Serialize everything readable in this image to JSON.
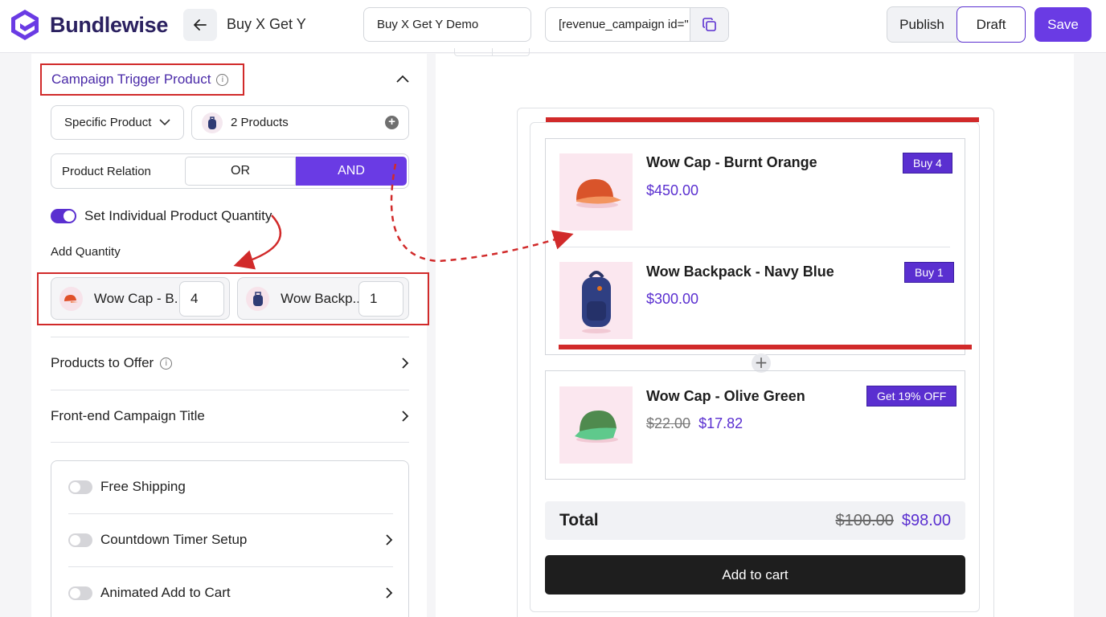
{
  "header": {
    "brand": "Bundlewise",
    "campaign_name": "Buy X Get Y",
    "title_value": "Buy X Get Y Demo",
    "shortcode_value": "[revenue_campaign id=\"",
    "publish_label": "Publish",
    "draft_label": "Draft",
    "save_label": "Save"
  },
  "trigger": {
    "title": "Campaign Trigger Product",
    "info_glyph": "i",
    "select_value": "Specific Product",
    "products_value": "2 Products",
    "relation_label": "Product Relation",
    "relation_or": "OR",
    "relation_and": "AND",
    "relation_selected": "AND",
    "individual_qty_label": "Set Individual Product Quantity",
    "individual_qty_enabled": true,
    "add_qty_label": "Add Quantity",
    "qty_items": [
      {
        "name": "Wow Cap - B...",
        "qty": "4"
      },
      {
        "name": "Wow Backp...",
        "qty": "1"
      }
    ]
  },
  "sections": {
    "products_to_offer": "Products to Offer",
    "frontend_title": "Front-end Campaign Title"
  },
  "options": [
    {
      "label": "Free Shipping",
      "enabled": false,
      "has_chevron": false
    },
    {
      "label": "Countdown Timer Setup",
      "enabled": false,
      "has_chevron": true
    },
    {
      "label": "Animated Add to Cart",
      "enabled": false,
      "has_chevron": true
    }
  ],
  "preview": {
    "buy_items": [
      {
        "name": "Wow Cap - Burnt Orange",
        "price": "$450.00",
        "badge": "Buy 4"
      },
      {
        "name": "Wow Backpack - Navy Blue",
        "price": "$300.00",
        "badge": "Buy 1"
      }
    ],
    "plus_glyph": "+",
    "get_item": {
      "name": "Wow Cap - Olive Green",
      "old_price": "$22.00",
      "price": "$17.82",
      "badge": "Get 19% OFF"
    },
    "total_label": "Total",
    "total_old": "$100.00",
    "total_new": "$98.00",
    "cart_label": "Add to cart"
  },
  "colors": {
    "accent": "#6a3be4",
    "brand_dark": "#2b2160",
    "annotation_red": "#d12a2a",
    "thumb_bg": "#fbe7ef"
  },
  "icons": {
    "logo": "bundlewise-logo-icon",
    "back": "arrow-left-icon",
    "copy": "copy-icon",
    "collapse": "chevron-up-icon",
    "dropdown": "chevron-down-icon",
    "add": "plus-circle-icon",
    "section": "chevron-right-icon"
  }
}
